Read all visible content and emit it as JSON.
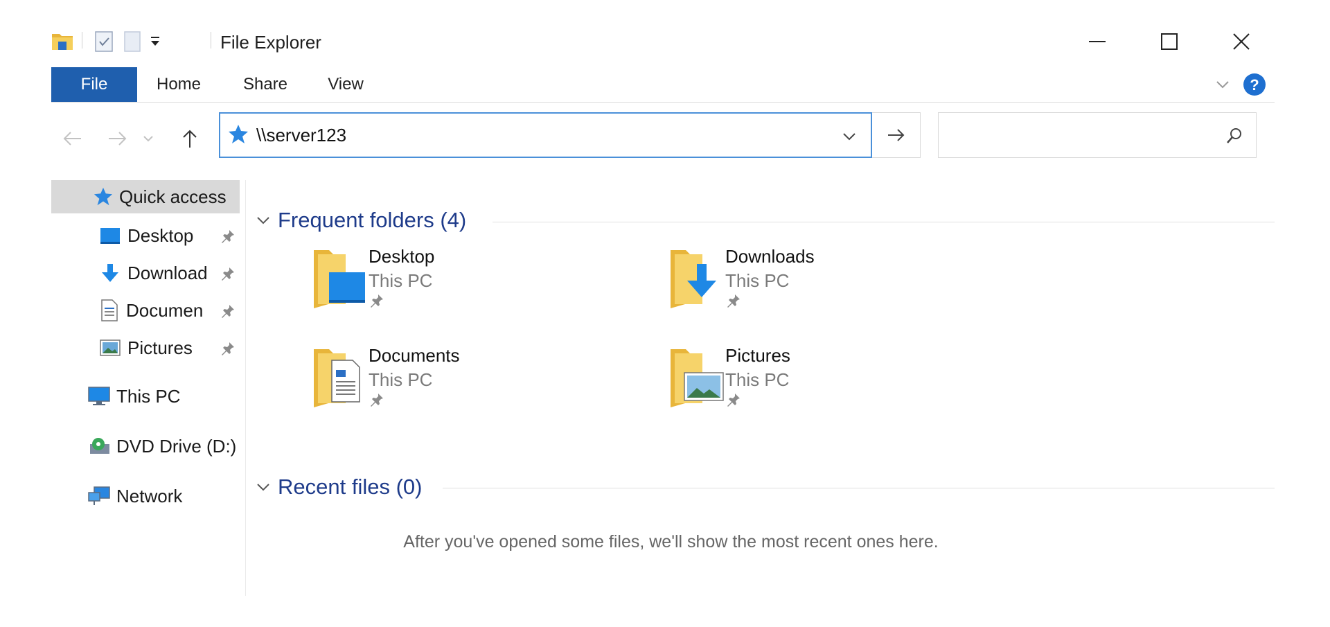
{
  "window": {
    "title": "File Explorer"
  },
  "ribbon": {
    "tabs": [
      {
        "label": "File",
        "active": true
      },
      {
        "label": "Home"
      },
      {
        "label": "Share"
      },
      {
        "label": "View"
      }
    ]
  },
  "address_bar": {
    "value": "\\\\server123",
    "icon": "quick-access-star-icon"
  },
  "search": {
    "placeholder": "",
    "icon": "search-icon"
  },
  "nav_pane": {
    "quick_access": "Quick access",
    "pinned": [
      {
        "label": "Desktop",
        "icon": "desktop-icon"
      },
      {
        "label": "Download",
        "icon": "downloads-icon"
      },
      {
        "label": "Documen",
        "icon": "documents-icon"
      },
      {
        "label": "Pictures",
        "icon": "pictures-icon"
      }
    ],
    "this_pc": "This PC",
    "dvd": "DVD Drive (D:)",
    "network": "Network"
  },
  "frequent_folders": {
    "header": "Frequent folders (4)",
    "items": [
      {
        "name": "Desktop",
        "location": "This PC"
      },
      {
        "name": "Downloads",
        "location": "This PC"
      },
      {
        "name": "Documents",
        "location": "This PC"
      },
      {
        "name": "Pictures",
        "location": "This PC"
      }
    ]
  },
  "recent_files": {
    "header": "Recent files (0)",
    "empty_message": "After you've opened some files, we'll show the most recent ones here."
  },
  "colors": {
    "file_tab": "#1f5fae",
    "section_header": "#1e3b8a",
    "address_border": "#4a90d9",
    "folder": "#f2c94c",
    "accent_blue": "#1e88e5"
  }
}
